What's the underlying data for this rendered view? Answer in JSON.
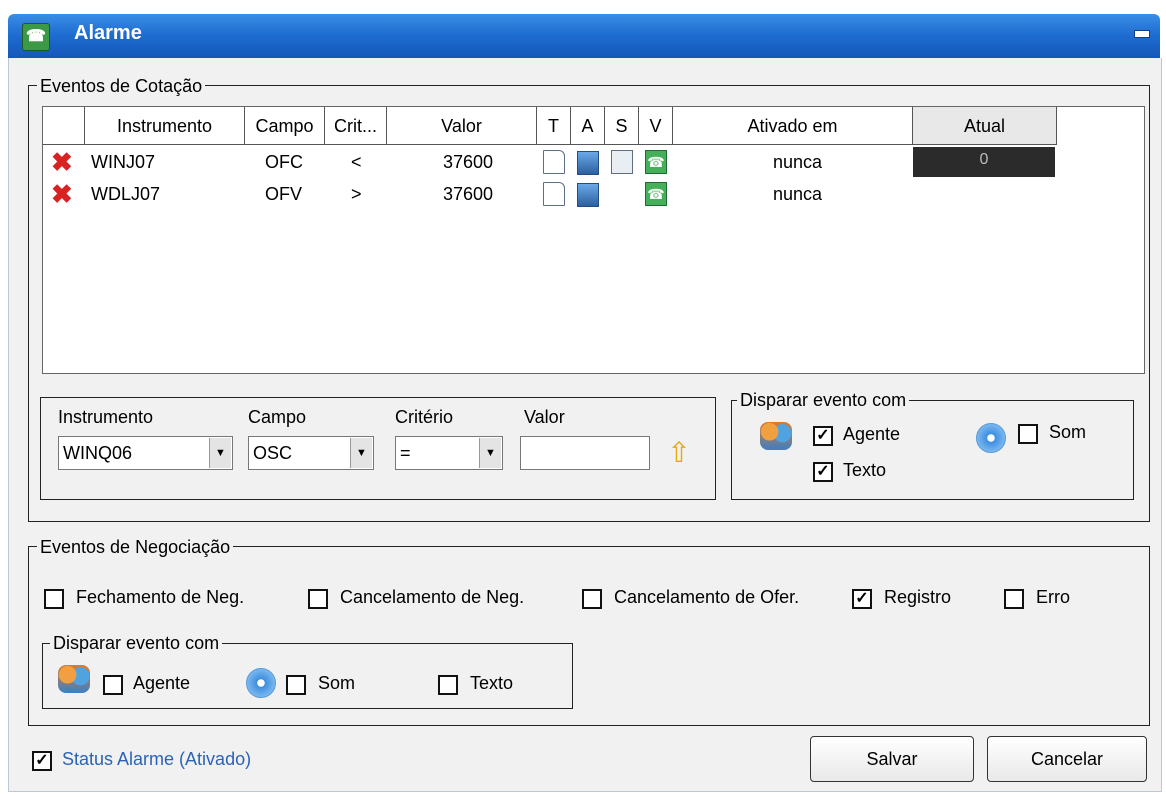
{
  "window": {
    "title": "Alarme"
  },
  "cotacao": {
    "legend": "Eventos de Cotação",
    "columns": [
      "Instrumento",
      "Campo",
      "Crit...",
      "Valor",
      "T",
      "A",
      "S",
      "V",
      "Ativado em",
      "Atual"
    ],
    "rows": [
      {
        "instrumento": "WINJ07",
        "campo": "OFC",
        "criterio": "<",
        "valor": "37600",
        "ativado_em": "nunca",
        "atual": "0"
      },
      {
        "instrumento": "WDLJ07",
        "campo": "OFV",
        "criterio": ">",
        "valor": "37600",
        "ativado_em": "nunca",
        "atual": ""
      }
    ],
    "form": {
      "instrumento_label": "Instrumento",
      "instrumento_value": "WINQ06",
      "campo_label": "Campo",
      "campo_value": "OSC",
      "criterio_label": "Critério",
      "criterio_value": "=",
      "valor_label": "Valor",
      "valor_value": ""
    },
    "disparar": {
      "legend": "Disparar evento com",
      "agente_label": "Agente",
      "agente_checked": true,
      "som_label": "Som",
      "som_checked": false,
      "texto_label": "Texto",
      "texto_checked": true
    }
  },
  "negociacao": {
    "legend": "Eventos de Negociação",
    "options": [
      {
        "label": "Fechamento de Neg.",
        "checked": false
      },
      {
        "label": "Cancelamento de Neg.",
        "checked": false
      },
      {
        "label": "Cancelamento de Ofer.",
        "checked": false
      },
      {
        "label": "Registro",
        "checked": true
      },
      {
        "label": "Erro",
        "checked": false
      }
    ],
    "disparar": {
      "legend": "Disparar evento com",
      "agente_label": "Agente",
      "agente_checked": false,
      "som_label": "Som",
      "som_checked": false,
      "texto_label": "Texto",
      "texto_checked": false
    }
  },
  "footer": {
    "status_label": "Status Alarme (Ativado)",
    "status_checked": true,
    "save_label": "Salvar",
    "cancel_label": "Cancelar"
  },
  "colors": {
    "titlebar": "#1d6bd0",
    "status_text": "#2a63b8",
    "atual_bg": "#2b2b2b"
  }
}
